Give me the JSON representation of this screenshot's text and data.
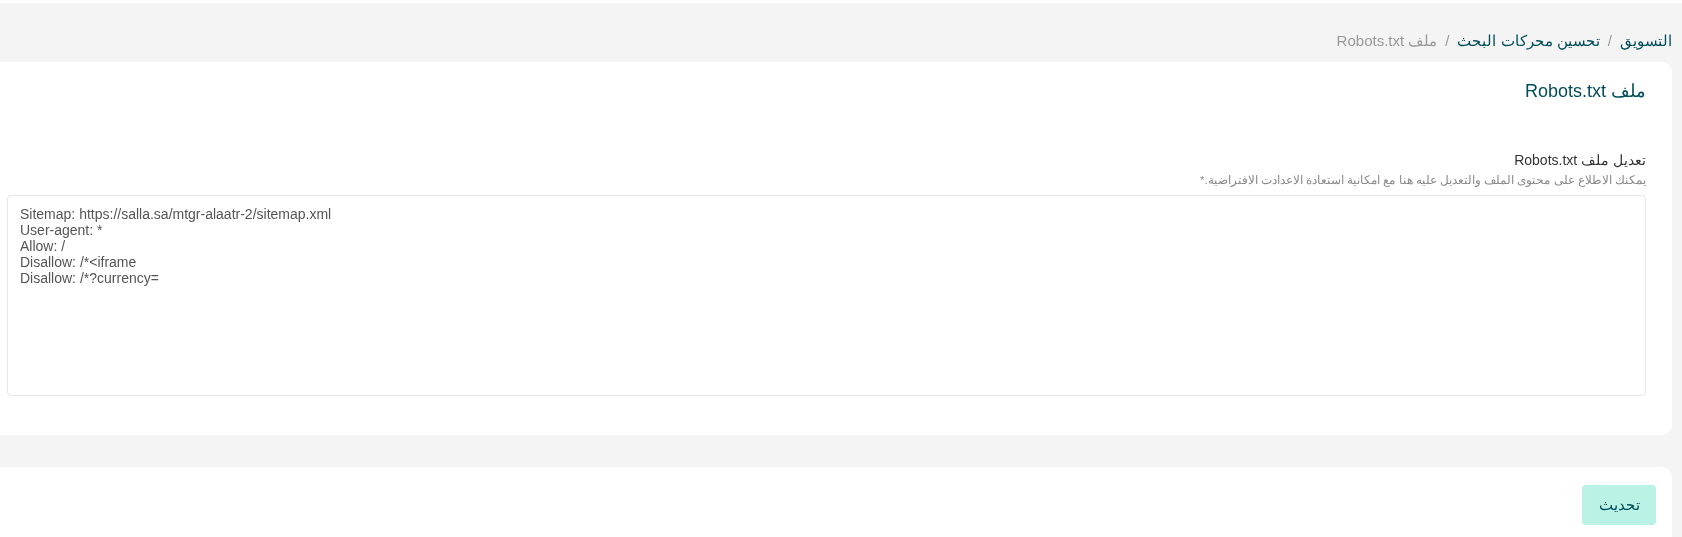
{
  "breadcrumb": {
    "separator": "/",
    "items": [
      {
        "label": "التسويق",
        "current": false
      },
      {
        "label": "تحسين محركات البحث",
        "current": false
      },
      {
        "label": "ملف Robots.txt",
        "current": true
      }
    ]
  },
  "card": {
    "title": "ملف Robots.txt",
    "field": {
      "label": "تعديل ملف Robots.txt",
      "hint": "يمكنك الاطلاع على محتوى الملف والتعديل عليه هنا مع امكانية استعادة الاعدادت الافتراضية.*",
      "value": "Sitemap: https://salla.sa/mtgr-alaatr-2/sitemap.xml\nUser-agent: *\nAllow: /\nDisallow: /*<iframe\nDisallow: /*?currency="
    }
  },
  "actions": {
    "submit": "تحديث"
  }
}
